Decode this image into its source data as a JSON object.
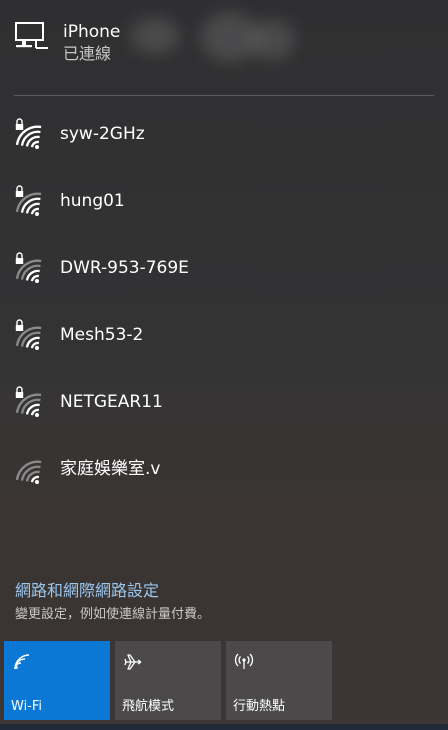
{
  "connected_network": {
    "ssid": "iPhone",
    "status": "已連線",
    "icon": "ethernet-pc-icon"
  },
  "networks": [
    {
      "name": "syw-2GHz",
      "secured": true,
      "signal_bars": 4
    },
    {
      "name": "hung01",
      "secured": true,
      "signal_bars": 3
    },
    {
      "name": "DWR-953-769E",
      "secured": true,
      "signal_bars": 2
    },
    {
      "name": "Mesh53-2",
      "secured": true,
      "signal_bars": 2
    },
    {
      "name": "NETGEAR11",
      "secured": true,
      "signal_bars": 2
    },
    {
      "name": "家庭娛樂室.v",
      "secured": false,
      "signal_bars": 1
    }
  ],
  "settings": {
    "link_label": "網路和網際網路設定",
    "description": "變更設定，例如使連線計量付費。"
  },
  "quick_actions": [
    {
      "label": "Wi-Fi",
      "icon": "wifi-icon",
      "active": true
    },
    {
      "label": "飛航模式",
      "icon": "airplane-icon",
      "active": false
    },
    {
      "label": "行動熱點",
      "icon": "hotspot-icon",
      "active": false
    }
  ],
  "colors": {
    "accent": "#0a78d4",
    "link": "#99c6ee",
    "tile_inactive": "#4b4949",
    "background": "#323233",
    "signal_active": "#ffffff",
    "signal_dim": "#8a8a8a"
  }
}
